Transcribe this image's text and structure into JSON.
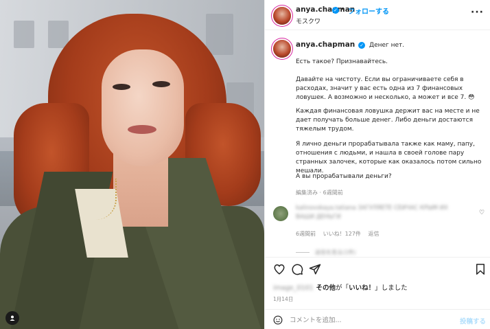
{
  "post": {
    "username": "anya.chapman",
    "follow_label": "フォローする",
    "separator": "•",
    "location": "モスクワ",
    "caption": {
      "username": "anya.chapman",
      "first_line": "Денег нет.",
      "p1": "Есть такое? Признавайтесь.",
      "p2": "Давайте на чистоту. Если вы ограничиваете себя в расходах, значит у вас есть одна из 7 финансовых ловушек. А возможно и несколько, а может и все 7. 😳",
      "p3": "Каждая финансовая ловушка держит вас на месте и не дает получать больше денег. Либо деньги достаются тяжелым трудом.",
      "p4": "Я лично деньги прорабатывала также как маму, папу, отношения с людьми, и нашла в своей голове пару странных залочек, которые как оказалось потом сильно мешали.",
      "p5": "А вы прорабатывали деньги?"
    },
    "caption_meta": "編集済み · 6週間前",
    "comment": {
      "name": "kalinovskaya.tatiana ЗАГУЛЯЕТЕ СЕЙЧАС КРЫМ ИХ",
      "text_line2": "ВАШИ ДЕНЬГИ",
      "time": "6週間前",
      "likes": "いいね！127件",
      "reply": "返信",
      "view_replies": "返信を見る(1件)"
    },
    "likes_line": {
      "blurred_user": "image_0101",
      "others": "その他",
      "suffix_1": "が「",
      "likes_word": "いいね！",
      "suffix_2": "」しました"
    },
    "date": "1月14日",
    "comment_input": {
      "placeholder": "コメントを追加...",
      "post_label": "投稿する"
    }
  },
  "icons": [
    "verified-badge-icon",
    "more-options-icon",
    "heart-icon",
    "comment-icon",
    "share-icon",
    "bookmark-icon",
    "emoji-icon",
    "user-tag-icon"
  ],
  "colors": {
    "accent": "#0095f6",
    "post_disabled": "#b2dffc",
    "meta_gray": "#8e8e8e",
    "text": "#262626"
  }
}
